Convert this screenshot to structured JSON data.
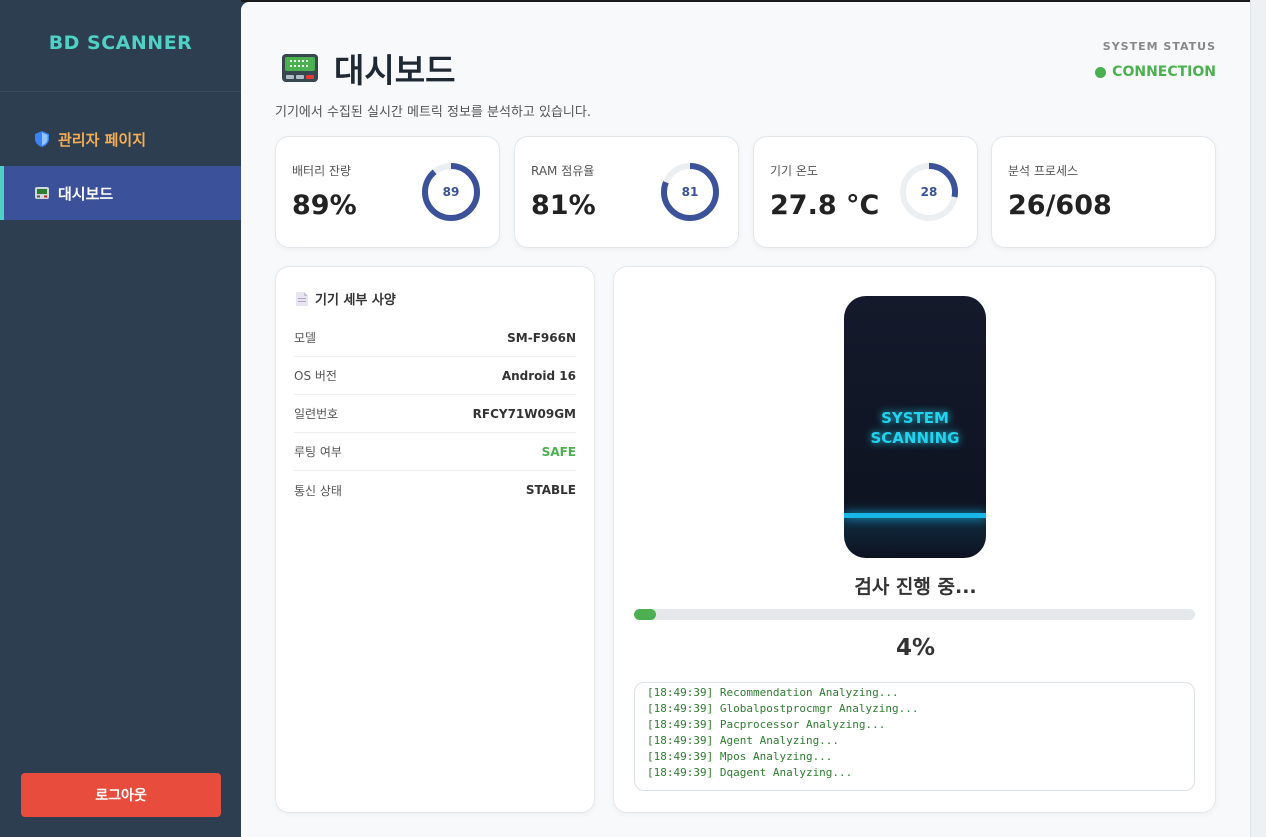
{
  "sidebar": {
    "brand": "BD SCANNER",
    "items": [
      {
        "label": "관리자 페이지",
        "icon": "shield-icon"
      },
      {
        "label": "대시보드",
        "icon": "dashboard-icon"
      }
    ],
    "logout_label": "로그아웃"
  },
  "header": {
    "title": "대시보드",
    "subtitle": "기기에서 수집된 실시간 메트릭 정보를 분석하고 있습니다.",
    "system_status_label": "SYSTEM STATUS",
    "system_status_value": "CONNECTION"
  },
  "metrics": [
    {
      "label": "배터리 잔량",
      "value": "89%",
      "ring": "89",
      "percent": 89
    },
    {
      "label": "RAM 점유율",
      "value": "81%",
      "ring": "81",
      "percent": 81
    },
    {
      "label": "기기 온도",
      "value": "27.8 °C",
      "ring": "28",
      "percent": 28
    },
    {
      "label": "분석 프로세스",
      "value": "26/608"
    }
  ],
  "specs": {
    "title": "기기 세부 사양",
    "rows": [
      {
        "key": "모델",
        "value": "SM-F966N"
      },
      {
        "key": "OS 버전",
        "value": "Android 16"
      },
      {
        "key": "일련번호",
        "value": "RFCY71W09GM"
      },
      {
        "key": "루팅 여부",
        "value": "SAFE"
      },
      {
        "key": "통신 상태",
        "value": "STABLE"
      }
    ]
  },
  "scan": {
    "phone_line1": "SYSTEM",
    "phone_line2": "SCANNING",
    "status": "검사 진행 중...",
    "progress_text": "4%",
    "progress_percent": 4,
    "logs": [
      "[18:49:39] Recommendation Analyzing...",
      "[18:49:39] Globalpostprocmgr Analyzing...",
      "[18:49:39] Pacprocessor Analyzing...",
      "[18:49:39] Agent Analyzing...",
      "[18:49:39] Mpos Analyzing...",
      "[18:49:39] Dqagent Analyzing..."
    ]
  },
  "colors": {
    "accent": "#4fd1c5",
    "ring": "#3b5199",
    "success": "#4caf50",
    "danger": "#e74c3c",
    "admin": "#f6ad55"
  }
}
